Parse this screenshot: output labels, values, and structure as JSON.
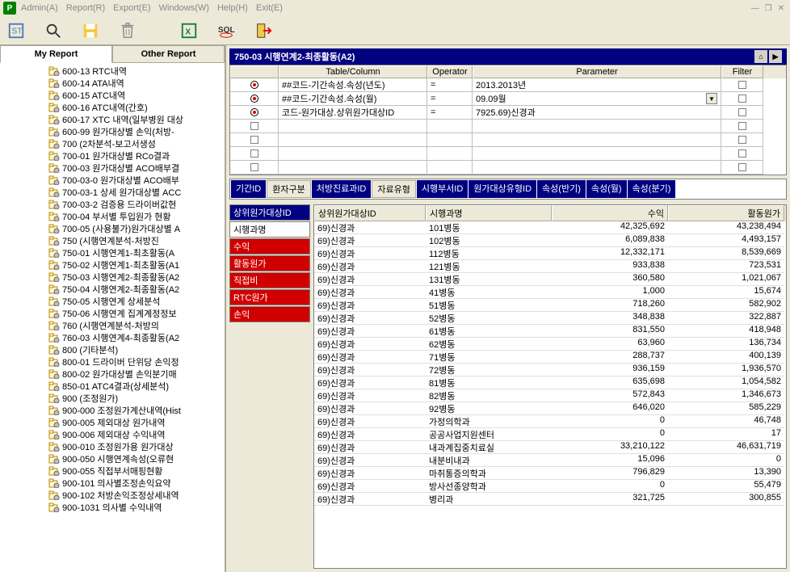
{
  "menu": [
    "Admin(A)",
    "Report(R)",
    "Export(E)",
    "Windows(W)",
    "Help(H)",
    "Exit(E)"
  ],
  "logo": "P",
  "tabs": {
    "my": "My Report",
    "other": "Other Report"
  },
  "tree": [
    "600-13 RTC내역",
    "600-14 ATA내역",
    "600-15 ATC내역",
    "600-16 ATC내역(간호)",
    "600-17 XTC 내역(일부병원 대상",
    "600-99 원가대상별 손익(처방-",
    "700       (2차분석-보고서생성",
    "700-01 원가대상별 RCo결과",
    "700-03 원가대상별 ACO배부결",
    "700-03-0 원가대상별 ACO배부",
    "700-03-1 상세 원가대상별 ACC",
    "700-03-2 검증용 드라이버값현",
    "700-04 부서별 투입원가 현황",
    "700-05 (사용불가)원가대상별 A",
    "750       (시행연계분석-처방진",
    "750-01 시행연계1-최초활동(A",
    "750-02 시행연계1-최초활동(A1",
    "750-03 시행연계2-최종활동(A2",
    "750-04 시행연계2-최종활동(A2",
    "750-05 시행연계 상세분석",
    "750-06 시행연계 집계계정정보",
    "760       (시행연계분석-처방의",
    "760-03 시행연계4-최종활동(A2",
    "800       (기타분석)",
    "800-01 드라이버 단위당 손익정",
    "800-02 원가대상별 손익분기매",
    "850-01 ATC4결과(상세분석)",
    "900       (조정원가)",
    "900-000 조정원가계산내역(Hist",
    "900-005 제외대상 원가내역",
    "900-006 제외대상 수익내역",
    "900-010 조정원가용 원가대상",
    "900-050 시행연계속성(오류현",
    "900-055 직접부서매핑현황",
    "900-101 의사별조정손익요약",
    "900-102 처방손익조정상세내역",
    "900-1031 의사별 수익내역"
  ],
  "title": "750-03 시행연계2-최종활동(A2)",
  "filter_head": {
    "tc": "Table/Column",
    "op": "Operator",
    "param": "Parameter",
    "filter": "Filter"
  },
  "filters": [
    {
      "r": true,
      "tc": "##코드-기간속성.속성(년도)",
      "op": "=",
      "p": "2013.2013년",
      "dd": false
    },
    {
      "r": true,
      "tc": "##코드-기간속성.속성(월)",
      "op": "=",
      "p": "09.09월",
      "dd": true
    },
    {
      "r": true,
      "tc": "코드-원가대상.상위원가대상ID",
      "op": "=",
      "p": "7925.69)신경과",
      "dd": false
    },
    {
      "r": false
    },
    {
      "r": false
    },
    {
      "r": false
    },
    {
      "r": false
    }
  ],
  "dims": [
    {
      "t": "기간ID",
      "s": "sel"
    },
    {
      "t": "환자구분",
      "s": "inv"
    },
    {
      "t": "처방진료과ID",
      "s": "sel"
    },
    {
      "t": "자료유형",
      "s": "inv"
    },
    {
      "t": "시행부서ID",
      "s": "sel"
    },
    {
      "t": "원가대상유형ID",
      "s": "sel"
    },
    {
      "t": "속성(반기)",
      "s": "sel"
    },
    {
      "t": "속성(월)",
      "s": "sel"
    },
    {
      "t": "속성(분기)",
      "s": "sel"
    }
  ],
  "sel": [
    {
      "t": "상위원가대상ID",
      "c": "sel"
    },
    {
      "t": "시행과명",
      "c": ""
    },
    {
      "t": "수익",
      "c": "red"
    },
    {
      "t": "활동원가",
      "c": "red"
    },
    {
      "t": "직접비",
      "c": "red"
    },
    {
      "t": "RTC원가",
      "c": "red"
    },
    {
      "t": "손익",
      "c": "red"
    }
  ],
  "dg_head": [
    "상위원가대상ID",
    "시행과명",
    "수익",
    "활동원가"
  ],
  "rows": [
    [
      "69)신경과",
      "101병동",
      "42,325,692",
      "43,238,494"
    ],
    [
      "69)신경과",
      "102병동",
      "6,089,838",
      "4,493,157"
    ],
    [
      "69)신경과",
      "112병동",
      "12,332,171",
      "8,539,669"
    ],
    [
      "69)신경과",
      "121병동",
      "933,838",
      "723,531"
    ],
    [
      "69)신경과",
      "131병동",
      "360,580",
      "1,021,067"
    ],
    [
      "69)신경과",
      "41병동",
      "1,000",
      "15,674"
    ],
    [
      "69)신경과",
      "51병동",
      "718,260",
      "582,902"
    ],
    [
      "69)신경과",
      "52병동",
      "348,838",
      "322,887"
    ],
    [
      "69)신경과",
      "61병동",
      "831,550",
      "418,948"
    ],
    [
      "69)신경과",
      "62병동",
      "63,960",
      "136,734"
    ],
    [
      "69)신경과",
      "71병동",
      "288,737",
      "400,139"
    ],
    [
      "69)신경과",
      "72병동",
      "936,159",
      "1,936,570"
    ],
    [
      "69)신경과",
      "81병동",
      "635,698",
      "1,054,582"
    ],
    [
      "69)신경과",
      "82병동",
      "572,843",
      "1,346,673"
    ],
    [
      "69)신경과",
      "92병동",
      "646,020",
      "585,229"
    ],
    [
      "69)신경과",
      "가정의학과",
      "0",
      "46,748"
    ],
    [
      "69)신경과",
      "공공사업지원센터",
      "0",
      "17"
    ],
    [
      "69)신경과",
      "내과계집중치료실",
      "33,210,122",
      "46,631,719"
    ],
    [
      "69)신경과",
      "내분비내과",
      "15,096",
      "0"
    ],
    [
      "69)신경과",
      "마취통증의학과",
      "796,829",
      "13,390"
    ],
    [
      "69)신경과",
      "방사선종양학과",
      "0",
      "55,479"
    ],
    [
      "69)신경과",
      "병리과",
      "321,725",
      "300,855"
    ]
  ]
}
